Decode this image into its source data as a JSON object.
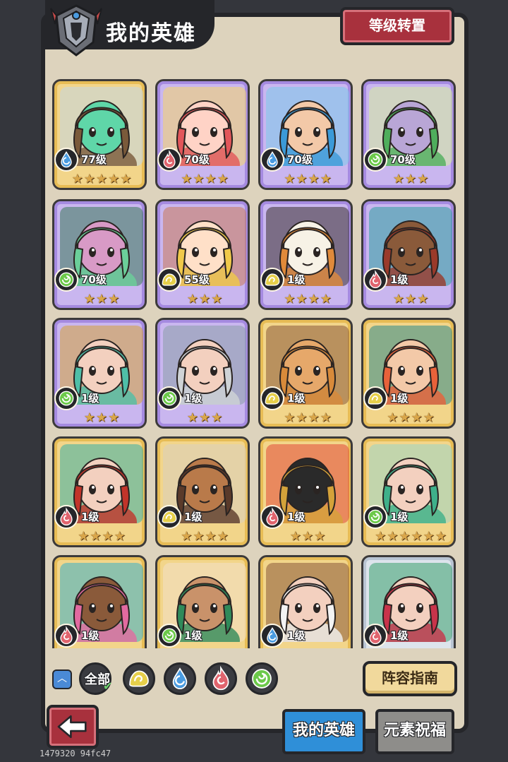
{
  "header": {
    "title": "我的英雄",
    "reset_button_label": "等级转置"
  },
  "element_colors": {
    "water": "#4a9be0",
    "fire": "#e0646e",
    "wind": "#6cc94a",
    "earth": "#e6cf4a"
  },
  "rarity_colors": {
    "gold": "#f2d58a",
    "purple": "#c9b6ef",
    "silver": "#dde4ec"
  },
  "heroes": [
    {
      "level": "77级",
      "element": "water",
      "stars": 5,
      "rarity": "gold",
      "palette": [
        "#7a5a3a",
        "#5fd6a8",
        "#c3d7e6"
      ]
    },
    {
      "level": "70级",
      "element": "fire",
      "stars": 4,
      "rarity": "purple",
      "palette": [
        "#e2565a",
        "#ffd3c6",
        "#f4d56a"
      ]
    },
    {
      "level": "70级",
      "element": "water",
      "stars": 4,
      "rarity": "purple",
      "palette": [
        "#3b9ad8",
        "#f3c9a8",
        "#7ccbe9"
      ]
    },
    {
      "level": "70级",
      "element": "wind",
      "stars": 3,
      "rarity": "purple",
      "palette": [
        "#4fae5c",
        "#b9a6d6",
        "#d6ec9c"
      ]
    },
    {
      "level": "70级",
      "element": "wind",
      "stars": 3,
      "rarity": "purple",
      "palette": [
        "#6bcf9a",
        "#d89ac6",
        "#3a7a5a"
      ]
    },
    {
      "level": "55级",
      "element": "earth",
      "stars": 3,
      "rarity": "purple",
      "palette": [
        "#f0c94a",
        "#ffe0c8",
        "#c97a5a"
      ]
    },
    {
      "level": "1级",
      "element": "earth",
      "stars": 4,
      "rarity": "purple",
      "palette": [
        "#e08a3a",
        "#f7f2e6",
        "#3a3230"
      ]
    },
    {
      "level": "1级",
      "element": "fire",
      "stars": 3,
      "rarity": "purple",
      "palette": [
        "#9a3a2a",
        "#8a5a3a",
        "#2fa0a0"
      ]
    },
    {
      "level": "1级",
      "element": "wind",
      "stars": 3,
      "rarity": "purple",
      "palette": [
        "#4fbfa8",
        "#f3d0bf",
        "#d4a23a"
      ]
    },
    {
      "level": "1级",
      "element": "wind",
      "stars": 3,
      "rarity": "purple",
      "palette": [
        "#cfd3d6",
        "#f3d0bf",
        "#8a9ea8"
      ]
    },
    {
      "level": "1级",
      "element": "earth",
      "stars": 4,
      "rarity": "gold",
      "palette": [
        "#d88a3a",
        "#e6a86a",
        "#8a5a3a"
      ]
    },
    {
      "level": "1级",
      "element": "earth",
      "stars": 4,
      "rarity": "gold",
      "palette": [
        "#e8623a",
        "#f3c9a8",
        "#2f8a8a"
      ]
    },
    {
      "level": "1级",
      "element": "fire",
      "stars": 4,
      "rarity": "gold",
      "palette": [
        "#c2342a",
        "#f3d0bf",
        "#3ab0a8"
      ]
    },
    {
      "level": "1级",
      "element": "earth",
      "stars": 4,
      "rarity": "gold",
      "palette": [
        "#5a3a2a",
        "#b97a4a",
        "#d8cfc0"
      ]
    },
    {
      "level": "1级",
      "element": "fire",
      "stars": 3,
      "rarity": "gold",
      "palette": [
        "#d4a23a",
        "#2a2a2a",
        "#e24a3a"
      ]
    },
    {
      "level": "1级",
      "element": "wind",
      "stars": 6,
      "rarity": "gold",
      "palette": [
        "#3fb08a",
        "#f3d0bf",
        "#9ad6c8"
      ]
    },
    {
      "level": "1级",
      "element": "fire",
      "stars": 0,
      "rarity": "gold",
      "palette": [
        "#e26aa0",
        "#8a5a3a",
        "#3ab0c8"
      ]
    },
    {
      "level": "1级",
      "element": "wind",
      "stars": 0,
      "rarity": "gold",
      "palette": [
        "#2f8a5a",
        "#c9926a",
        "#f3e0c8"
      ]
    },
    {
      "level": "1级",
      "element": "water",
      "stars": 0,
      "rarity": "gold",
      "palette": [
        "#f3f3f3",
        "#f3d0bf",
        "#8a5a3a"
      ]
    },
    {
      "level": "1级",
      "element": "fire",
      "stars": 0,
      "rarity": "silver",
      "palette": [
        "#c8344a",
        "#f3d0bf",
        "#3aa070"
      ]
    }
  ],
  "filter": {
    "all_label": "全部",
    "elements": [
      "earth",
      "water",
      "fire",
      "wind"
    ]
  },
  "guide_button_label": "阵容指南",
  "tabs": [
    {
      "label": "我的英雄",
      "active": true
    },
    {
      "label": "元素祝福",
      "active": false
    }
  ],
  "build_id": "1479320 94fc47"
}
